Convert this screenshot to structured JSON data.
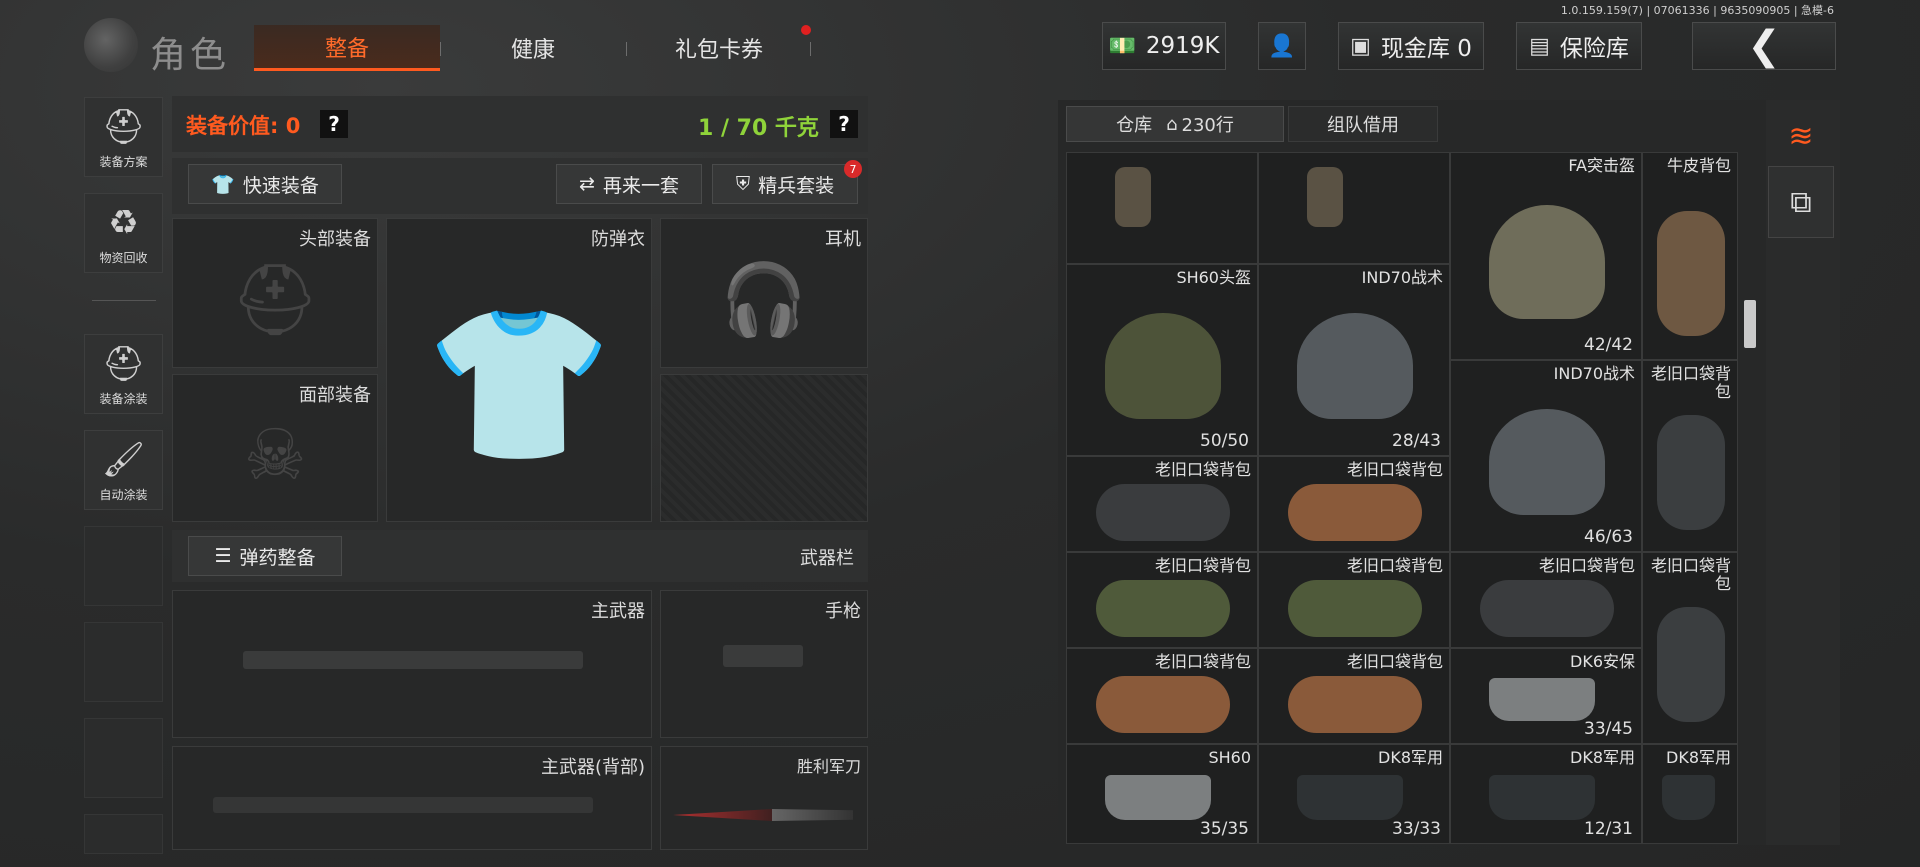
{
  "version": "1.0.159.159(7) | 07061336 | 9635090905 | 急模-6",
  "header": {
    "title": "角色",
    "tabs": [
      {
        "label": "整备",
        "active": true
      },
      {
        "label": "健康",
        "active": false
      },
      {
        "label": "礼包卡券",
        "active": false,
        "badge": true
      }
    ],
    "currency": "2919K",
    "cash_vault": "现金库 0",
    "safe": "保险库",
    "back_icon": "chevron-left-icon"
  },
  "sidebar": [
    {
      "label": "装备方案",
      "icon": "helmet-plan-icon"
    },
    {
      "label": "物资回收",
      "icon": "recycle-icon"
    },
    {
      "label": "装备涂装",
      "icon": "paint-helmet-icon"
    },
    {
      "label": "自动涂装",
      "icon": "auto-paint-icon"
    }
  ],
  "equipment": {
    "value_label": "装备价值: 0",
    "weight": "1 / 70 千克",
    "quick_equip": "快速装备",
    "again": "再来一套",
    "elite": "精兵套装",
    "elite_badge": "7",
    "slots": {
      "head": "头部装备",
      "armor": "防弹衣",
      "headset": "耳机",
      "face": "面部装备"
    },
    "ammo": "弹药整备",
    "weapon_bar": "武器栏",
    "primary": "主武器",
    "pistol": "手枪",
    "primary_back": "主武器(背部)",
    "knife": "胜利军刀"
  },
  "inventory": {
    "tabs": [
      {
        "label": "仓库",
        "extra": "230行",
        "active": true
      },
      {
        "label": "组队借用",
        "active": false
      }
    ],
    "items": [
      {
        "name": "",
        "count": "",
        "type": "headset"
      },
      {
        "name": "",
        "count": "",
        "type": "headset"
      },
      {
        "name": "FA突击盔",
        "count": "42/42",
        "type": "helmet-tan"
      },
      {
        "name": "牛皮背包",
        "count": "",
        "type": "backpack"
      },
      {
        "name": "SH60头盔",
        "count": "50/50",
        "type": "helmet-green"
      },
      {
        "name": "IND70战术",
        "count": "28/43",
        "type": "helmet-visor"
      },
      {
        "name": "IND70战术",
        "count": "46/63",
        "type": "helmet-visor"
      },
      {
        "name": "老旧口袋背包",
        "count": "",
        "type": "bag-tall"
      },
      {
        "name": "老旧口袋背包",
        "count": "",
        "type": "bag-black"
      },
      {
        "name": "老旧口袋背包",
        "count": "",
        "type": "bag-brown"
      },
      {
        "name": "老旧口袋背包",
        "count": "",
        "type": "bag-camo"
      },
      {
        "name": "老旧口袋背包",
        "count": "",
        "type": "bag-camo"
      },
      {
        "name": "老旧口袋背包",
        "count": "",
        "type": "bag-black"
      },
      {
        "name": "老旧口袋背包",
        "count": "",
        "type": "bag-tall"
      },
      {
        "name": "老旧口袋背包",
        "count": "",
        "type": "bag-brown"
      },
      {
        "name": "老旧口袋背包",
        "count": "",
        "type": "bag-brown"
      },
      {
        "name": "DK6安保",
        "count": "33/45",
        "type": "visor"
      },
      {
        "name": "SH60",
        "count": "35/35",
        "type": "visor"
      },
      {
        "name": "DK8军用",
        "count": "33/33",
        "type": "visor-dark"
      },
      {
        "name": "DK8军用",
        "count": "12/31",
        "type": "visor-dark"
      },
      {
        "name": "DK8军用",
        "count": "",
        "type": "visor-dark"
      }
    ]
  },
  "colors": {
    "accent": "#ff5a1f",
    "weight_green": "#8fd33a"
  }
}
